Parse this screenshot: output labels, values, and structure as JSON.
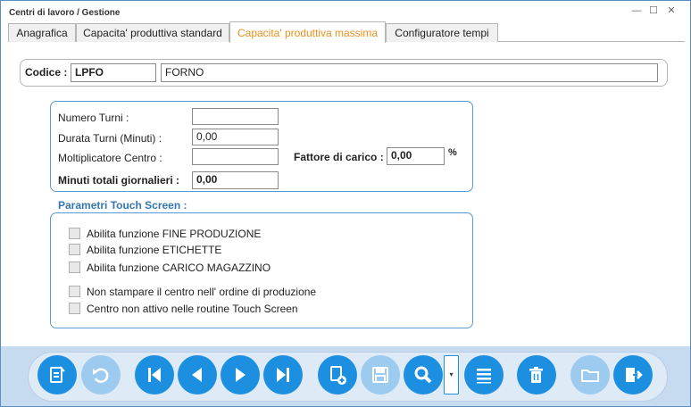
{
  "window": {
    "title": "Centri di lavoro / Gestione",
    "minimize_glyph": "—",
    "maximize_glyph": "☐",
    "close_glyph": "✕"
  },
  "tabs": [
    {
      "label": "Anagrafica"
    },
    {
      "label": "Capacita' produttiva standard"
    },
    {
      "label": "Capacita' produttiva massima"
    },
    {
      "label": "Configuratore tempi"
    }
  ],
  "active_tab": 2,
  "codice": {
    "label": "Codice :",
    "code_value": "LPFO",
    "description_value": "FORNO"
  },
  "capacity": {
    "numero_turni_label": "Numero Turni :",
    "numero_turni_value": "",
    "durata_turni_label": "Durata Turni (Minuti) :",
    "durata_turni_value": "0,00",
    "moltiplicatore_label": "Moltiplicatore Centro :",
    "moltiplicatore_value": "",
    "fattore_carico_label": "Fattore di carico :",
    "fattore_carico_value": "0,00",
    "percent_sign": "%",
    "minuti_totali_label": "Minuti totali giornalieri :",
    "minuti_totali_value": "0,00"
  },
  "touch_screen": {
    "title": "Parametri Touch Screen :",
    "options": [
      {
        "label": "Abilita funzione FINE PRODUZIONE",
        "checked": false
      },
      {
        "label": "Abilita funzione ETICHETTE",
        "checked": false
      },
      {
        "label": "Abilita funzione CARICO MAGAZZINO",
        "checked": false
      },
      {
        "label": "Non stampare il centro nell' ordine di produzione",
        "checked": false
      },
      {
        "label": "Centro non attivo nelle routine Touch Screen",
        "checked": false
      }
    ]
  },
  "toolbar": {
    "buttons": [
      {
        "icon": "edit-document-icon",
        "enabled": true
      },
      {
        "icon": "undo-icon",
        "enabled": false
      },
      {
        "icon": "first-record-icon",
        "enabled": true
      },
      {
        "icon": "previous-record-icon",
        "enabled": true
      },
      {
        "icon": "next-record-icon",
        "enabled": true
      },
      {
        "icon": "last-record-icon",
        "enabled": true
      },
      {
        "icon": "new-document-icon",
        "enabled": true
      },
      {
        "icon": "save-icon",
        "enabled": false
      },
      {
        "icon": "search-icon",
        "enabled": true
      },
      {
        "icon": "list-icon",
        "enabled": true
      },
      {
        "icon": "delete-icon",
        "enabled": true
      },
      {
        "icon": "folder-icon",
        "enabled": false
      },
      {
        "icon": "exit-icon",
        "enabled": true
      }
    ],
    "dropdown_glyph": "▾",
    "accent_color": "#1d8fe0",
    "disabled_color": "#9ccbef"
  }
}
